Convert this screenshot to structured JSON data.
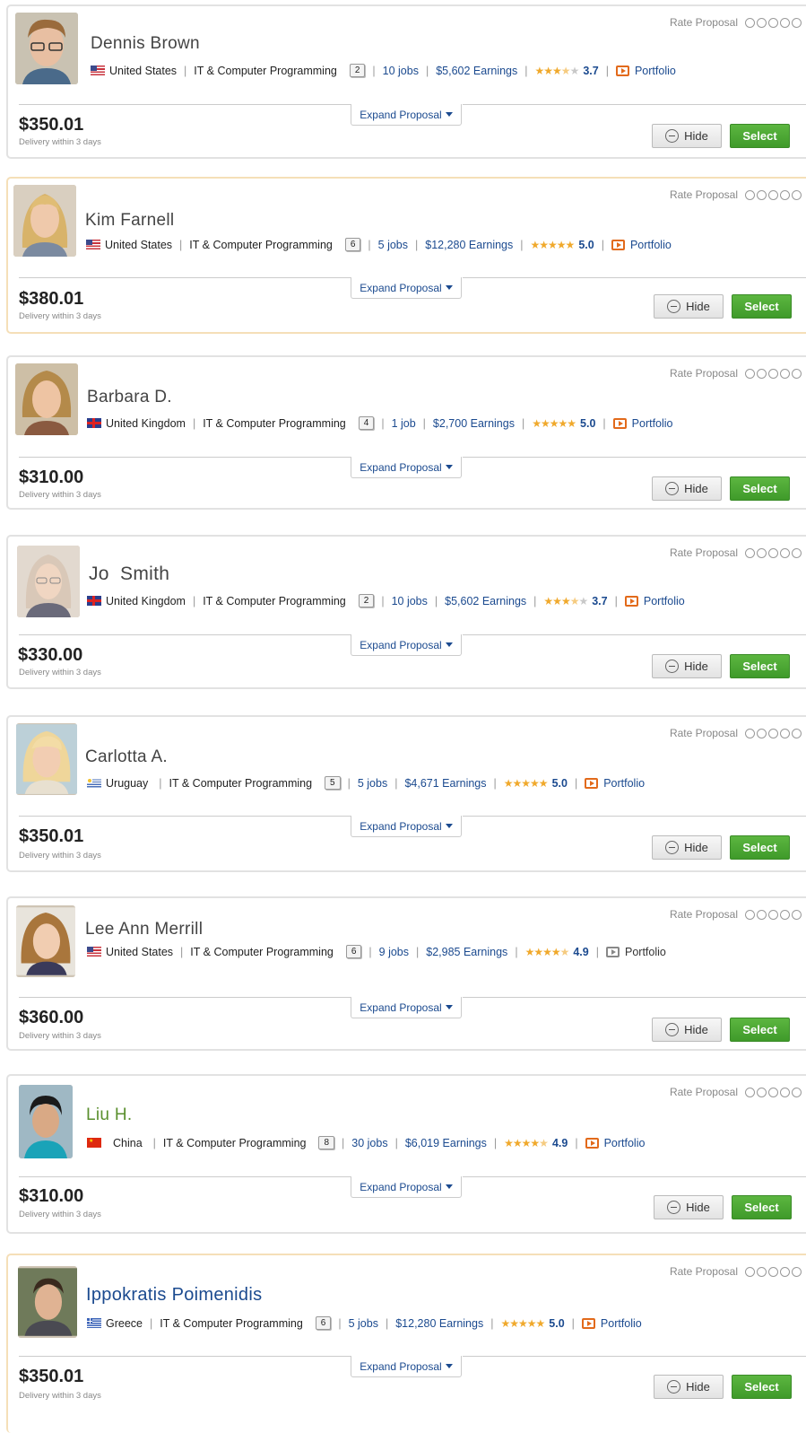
{
  "labels": {
    "rate_proposal": "Rate Proposal",
    "expand_proposal": "Expand Proposal",
    "hide": "Hide",
    "select": "Select",
    "portfolio": "Portfolio",
    "category": "IT & Computer Programming"
  },
  "proposals": [
    {
      "name": "Dennis Brown",
      "country": "United States",
      "flag": "us",
      "badge": "2",
      "jobs": "10 jobs",
      "earnings": "$5,602 Earnings",
      "rating": "3.7",
      "stars": 3.5,
      "price": "$350.01",
      "delivery": "Delivery within 3 days"
    },
    {
      "name": "Kim Farnell",
      "country": "United States",
      "flag": "us",
      "badge": "6",
      "jobs": "5 jobs",
      "earnings": "$12,280 Earnings",
      "rating": "5.0",
      "stars": 5,
      "price": "$380.01",
      "delivery": "Delivery within 3 days"
    },
    {
      "name": "Barbara D.",
      "country": "United Kingdom",
      "flag": "uk",
      "badge": "4",
      "jobs": "1 job",
      "earnings": "$2,700 Earnings",
      "rating": "5.0",
      "stars": 5,
      "price": "$310.00",
      "delivery": "Delivery within 3 days"
    },
    {
      "name": "Jo  Smith",
      "country": "United Kingdom",
      "flag": "uk",
      "badge": "2",
      "jobs": "10 jobs",
      "earnings": "$5,602 Earnings",
      "rating": "3.7",
      "stars": 3.5,
      "price": "$330.00",
      "delivery": "Delivery within 3 days"
    },
    {
      "name": "Carlotta A.",
      "country": "Uruguay",
      "flag": "uy",
      "badge": "5",
      "jobs": "5 jobs",
      "earnings": "$4,671 Earnings",
      "rating": "5.0",
      "stars": 5,
      "price": "$350.01",
      "delivery": "Delivery within 3 days"
    },
    {
      "name": "Lee Ann Merrill",
      "country": "United States",
      "flag": "us",
      "badge": "6",
      "jobs": "9 jobs",
      "earnings": "$2,985 Earnings",
      "rating": "4.9",
      "stars": 4.5,
      "price": "$360.00",
      "delivery": "Delivery within 3 days"
    },
    {
      "name": "Liu H.",
      "country": "China",
      "flag": "cn",
      "badge": "8",
      "jobs": "30 jobs",
      "earnings": "$6,019 Earnings",
      "rating": "4.9",
      "stars": 4.5,
      "price": "$310.00",
      "delivery": "Delivery within 3 days"
    },
    {
      "name": "Ippokratis Poimenidis",
      "country": "Greece",
      "flag": "gr",
      "badge": "6",
      "jobs": "5 jobs",
      "earnings": "$12,280 Earnings",
      "rating": "5.0",
      "stars": 5,
      "price": "$350.01",
      "delivery": "Delivery within 3 days"
    }
  ],
  "colors": {
    "select_green": "#4ca935",
    "link_blue": "#1b4a8f",
    "star_gold": "#f0a92c",
    "portfolio_orange": "#e26a1b",
    "highlight_border": "#f5dfb8"
  }
}
